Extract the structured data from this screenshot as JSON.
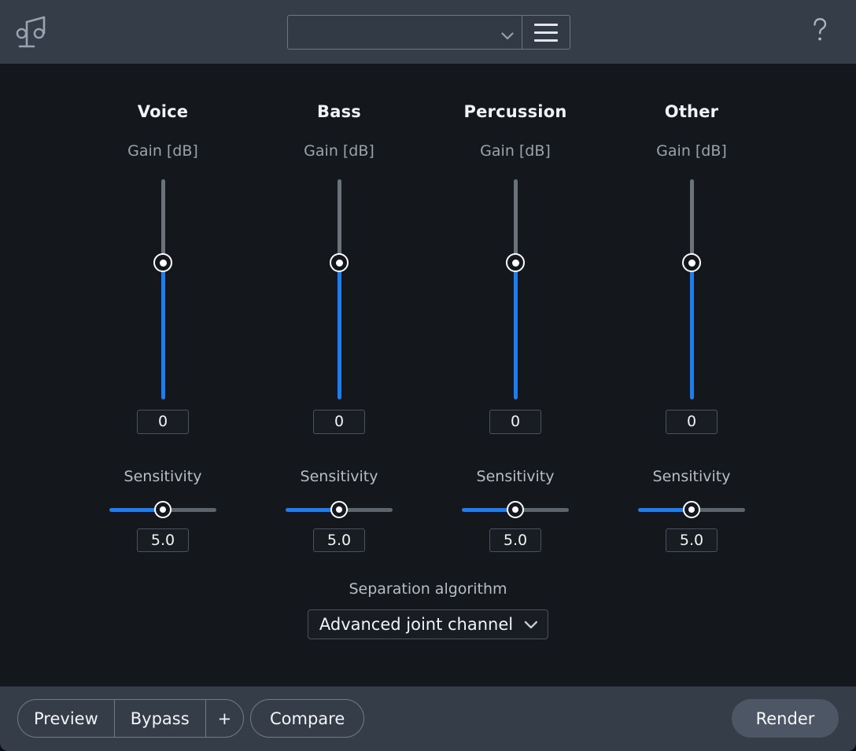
{
  "app": {
    "logo_icon": "music-note-icon",
    "help_icon": "question-mark-icon",
    "menu_icon": "hamburger-icon",
    "accent_color": "#1e7ef0",
    "header_bg": "#353d49",
    "body_bg": "#14171b"
  },
  "header": {
    "preset": {
      "value": "",
      "placeholder": "",
      "chevron_icon": "chevron-down-icon"
    },
    "menu_label": "",
    "help_label": "?"
  },
  "stems": [
    {
      "name": "Voice",
      "gain_label": "Gain [dB]",
      "gain_value": "0",
      "gain_slider": {
        "position_pct": 38,
        "min": -100,
        "max": 0
      },
      "sensitivity_label": "Sensitivity",
      "sensitivity_value": "5.0",
      "sensitivity_slider": {
        "position_pct": 50,
        "min": 0,
        "max": 10
      }
    },
    {
      "name": "Bass",
      "gain_label": "Gain [dB]",
      "gain_value": "0",
      "gain_slider": {
        "position_pct": 38,
        "min": -100,
        "max": 0
      },
      "sensitivity_label": "Sensitivity",
      "sensitivity_value": "5.0",
      "sensitivity_slider": {
        "position_pct": 50,
        "min": 0,
        "max": 10
      }
    },
    {
      "name": "Percussion",
      "gain_label": "Gain [dB]",
      "gain_value": "0",
      "gain_slider": {
        "position_pct": 38,
        "min": -100,
        "max": 0
      },
      "sensitivity_label": "Sensitivity",
      "sensitivity_value": "5.0",
      "sensitivity_slider": {
        "position_pct": 50,
        "min": 0,
        "max": 10
      }
    },
    {
      "name": "Other",
      "gain_label": "Gain [dB]",
      "gain_value": "0",
      "gain_slider": {
        "position_pct": 38,
        "min": -100,
        "max": 0
      },
      "sensitivity_label": "Sensitivity",
      "sensitivity_value": "5.0",
      "sensitivity_slider": {
        "position_pct": 50,
        "min": 0,
        "max": 10
      }
    }
  ],
  "algorithm": {
    "label": "Separation algorithm",
    "value": "Advanced joint channel",
    "chevron_icon": "chevron-down-icon"
  },
  "footer": {
    "preview_label": "Preview",
    "bypass_label": "Bypass",
    "plus_label": "+",
    "compare_label": "Compare",
    "render_label": "Render"
  }
}
